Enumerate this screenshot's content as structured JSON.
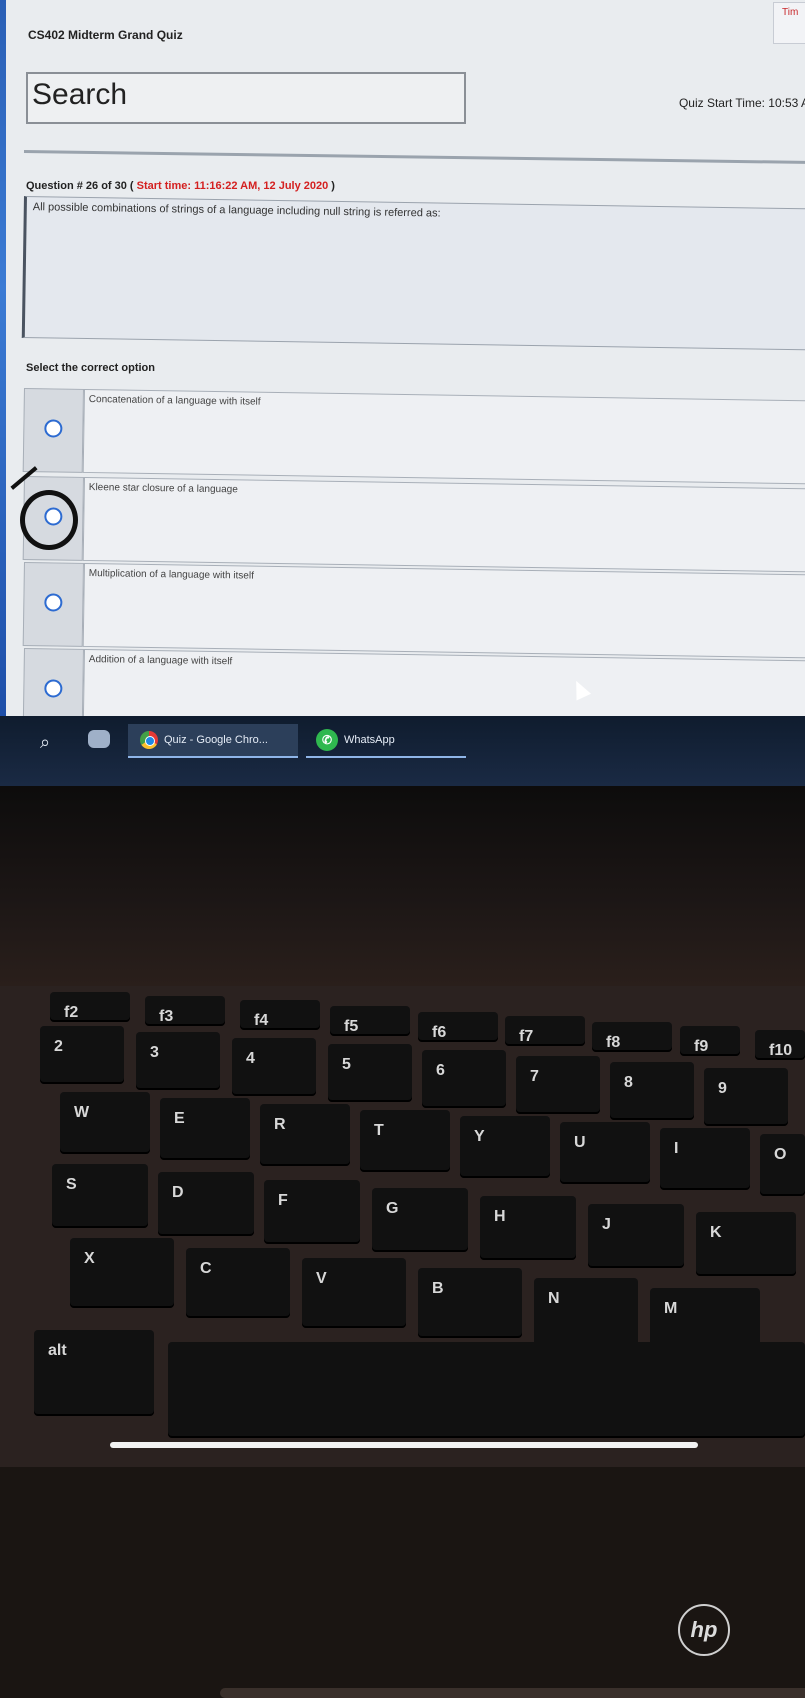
{
  "quiz": {
    "title": "CS402 Midterm Grand Quiz",
    "timer_label": "Tim",
    "search_label": "Search",
    "start_time_label": "Quiz Start Time: 10:53 A",
    "question_header_prefix": "Question # 26 of 30 (",
    "question_start_time": "Start time: 11:16:22 AM, 12 July 2020",
    "question_header_suffix": ")",
    "question_text": "All possible combinations of strings of a language including null string is referred as:",
    "select_label": "Select the correct option",
    "options": [
      "Concatenation of a language with itself",
      "Kleene star closure of a language",
      "Multiplication of a language with itself",
      "Addition of a language with itself"
    ]
  },
  "taskbar": {
    "search_icon": "search-icon",
    "chrome_label": "Quiz - Google Chro...",
    "whatsapp_label": "WhatsApp"
  },
  "laptop": {
    "brand": "hp",
    "function_row": [
      "f2",
      "f3",
      "f4",
      "f5",
      "f6",
      "f7",
      "f8",
      "f9",
      "f10"
    ],
    "number_row": [
      "2",
      "3",
      "4",
      "5",
      "6",
      "7",
      "8",
      "9"
    ],
    "top_row": [
      "W",
      "E",
      "R",
      "T",
      "Y",
      "U",
      "I",
      "O"
    ],
    "home_row": [
      "S",
      "D",
      "F",
      "G",
      "H",
      "J",
      "K"
    ],
    "bottom_row": [
      "X",
      "C",
      "V",
      "B",
      "N",
      "M"
    ],
    "alt_label": "alt"
  }
}
